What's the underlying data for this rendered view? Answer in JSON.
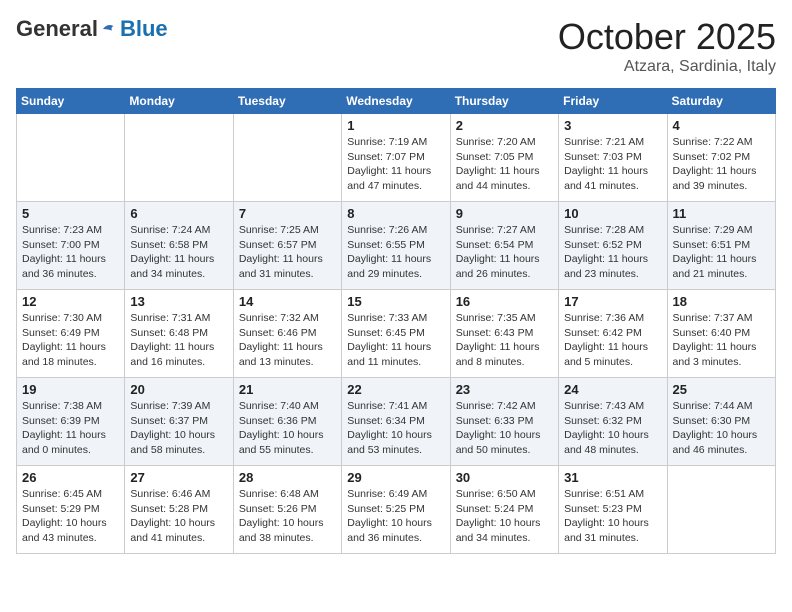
{
  "header": {
    "logo_general": "General",
    "logo_blue": "Blue",
    "month": "October 2025",
    "location": "Atzara, Sardinia, Italy"
  },
  "days_of_week": [
    "Sunday",
    "Monday",
    "Tuesday",
    "Wednesday",
    "Thursday",
    "Friday",
    "Saturday"
  ],
  "weeks": [
    [
      {
        "num": "",
        "sunrise": "",
        "sunset": "",
        "daylight": ""
      },
      {
        "num": "",
        "sunrise": "",
        "sunset": "",
        "daylight": ""
      },
      {
        "num": "",
        "sunrise": "",
        "sunset": "",
        "daylight": ""
      },
      {
        "num": "1",
        "sunrise": "Sunrise: 7:19 AM",
        "sunset": "Sunset: 7:07 PM",
        "daylight": "Daylight: 11 hours and 47 minutes."
      },
      {
        "num": "2",
        "sunrise": "Sunrise: 7:20 AM",
        "sunset": "Sunset: 7:05 PM",
        "daylight": "Daylight: 11 hours and 44 minutes."
      },
      {
        "num": "3",
        "sunrise": "Sunrise: 7:21 AM",
        "sunset": "Sunset: 7:03 PM",
        "daylight": "Daylight: 11 hours and 41 minutes."
      },
      {
        "num": "4",
        "sunrise": "Sunrise: 7:22 AM",
        "sunset": "Sunset: 7:02 PM",
        "daylight": "Daylight: 11 hours and 39 minutes."
      }
    ],
    [
      {
        "num": "5",
        "sunrise": "Sunrise: 7:23 AM",
        "sunset": "Sunset: 7:00 PM",
        "daylight": "Daylight: 11 hours and 36 minutes."
      },
      {
        "num": "6",
        "sunrise": "Sunrise: 7:24 AM",
        "sunset": "Sunset: 6:58 PM",
        "daylight": "Daylight: 11 hours and 34 minutes."
      },
      {
        "num": "7",
        "sunrise": "Sunrise: 7:25 AM",
        "sunset": "Sunset: 6:57 PM",
        "daylight": "Daylight: 11 hours and 31 minutes."
      },
      {
        "num": "8",
        "sunrise": "Sunrise: 7:26 AM",
        "sunset": "Sunset: 6:55 PM",
        "daylight": "Daylight: 11 hours and 29 minutes."
      },
      {
        "num": "9",
        "sunrise": "Sunrise: 7:27 AM",
        "sunset": "Sunset: 6:54 PM",
        "daylight": "Daylight: 11 hours and 26 minutes."
      },
      {
        "num": "10",
        "sunrise": "Sunrise: 7:28 AM",
        "sunset": "Sunset: 6:52 PM",
        "daylight": "Daylight: 11 hours and 23 minutes."
      },
      {
        "num": "11",
        "sunrise": "Sunrise: 7:29 AM",
        "sunset": "Sunset: 6:51 PM",
        "daylight": "Daylight: 11 hours and 21 minutes."
      }
    ],
    [
      {
        "num": "12",
        "sunrise": "Sunrise: 7:30 AM",
        "sunset": "Sunset: 6:49 PM",
        "daylight": "Daylight: 11 hours and 18 minutes."
      },
      {
        "num": "13",
        "sunrise": "Sunrise: 7:31 AM",
        "sunset": "Sunset: 6:48 PM",
        "daylight": "Daylight: 11 hours and 16 minutes."
      },
      {
        "num": "14",
        "sunrise": "Sunrise: 7:32 AM",
        "sunset": "Sunset: 6:46 PM",
        "daylight": "Daylight: 11 hours and 13 minutes."
      },
      {
        "num": "15",
        "sunrise": "Sunrise: 7:33 AM",
        "sunset": "Sunset: 6:45 PM",
        "daylight": "Daylight: 11 hours and 11 minutes."
      },
      {
        "num": "16",
        "sunrise": "Sunrise: 7:35 AM",
        "sunset": "Sunset: 6:43 PM",
        "daylight": "Daylight: 11 hours and 8 minutes."
      },
      {
        "num": "17",
        "sunrise": "Sunrise: 7:36 AM",
        "sunset": "Sunset: 6:42 PM",
        "daylight": "Daylight: 11 hours and 5 minutes."
      },
      {
        "num": "18",
        "sunrise": "Sunrise: 7:37 AM",
        "sunset": "Sunset: 6:40 PM",
        "daylight": "Daylight: 11 hours and 3 minutes."
      }
    ],
    [
      {
        "num": "19",
        "sunrise": "Sunrise: 7:38 AM",
        "sunset": "Sunset: 6:39 PM",
        "daylight": "Daylight: 11 hours and 0 minutes."
      },
      {
        "num": "20",
        "sunrise": "Sunrise: 7:39 AM",
        "sunset": "Sunset: 6:37 PM",
        "daylight": "Daylight: 10 hours and 58 minutes."
      },
      {
        "num": "21",
        "sunrise": "Sunrise: 7:40 AM",
        "sunset": "Sunset: 6:36 PM",
        "daylight": "Daylight: 10 hours and 55 minutes."
      },
      {
        "num": "22",
        "sunrise": "Sunrise: 7:41 AM",
        "sunset": "Sunset: 6:34 PM",
        "daylight": "Daylight: 10 hours and 53 minutes."
      },
      {
        "num": "23",
        "sunrise": "Sunrise: 7:42 AM",
        "sunset": "Sunset: 6:33 PM",
        "daylight": "Daylight: 10 hours and 50 minutes."
      },
      {
        "num": "24",
        "sunrise": "Sunrise: 7:43 AM",
        "sunset": "Sunset: 6:32 PM",
        "daylight": "Daylight: 10 hours and 48 minutes."
      },
      {
        "num": "25",
        "sunrise": "Sunrise: 7:44 AM",
        "sunset": "Sunset: 6:30 PM",
        "daylight": "Daylight: 10 hours and 46 minutes."
      }
    ],
    [
      {
        "num": "26",
        "sunrise": "Sunrise: 6:45 AM",
        "sunset": "Sunset: 5:29 PM",
        "daylight": "Daylight: 10 hours and 43 minutes."
      },
      {
        "num": "27",
        "sunrise": "Sunrise: 6:46 AM",
        "sunset": "Sunset: 5:28 PM",
        "daylight": "Daylight: 10 hours and 41 minutes."
      },
      {
        "num": "28",
        "sunrise": "Sunrise: 6:48 AM",
        "sunset": "Sunset: 5:26 PM",
        "daylight": "Daylight: 10 hours and 38 minutes."
      },
      {
        "num": "29",
        "sunrise": "Sunrise: 6:49 AM",
        "sunset": "Sunset: 5:25 PM",
        "daylight": "Daylight: 10 hours and 36 minutes."
      },
      {
        "num": "30",
        "sunrise": "Sunrise: 6:50 AM",
        "sunset": "Sunset: 5:24 PM",
        "daylight": "Daylight: 10 hours and 34 minutes."
      },
      {
        "num": "31",
        "sunrise": "Sunrise: 6:51 AM",
        "sunset": "Sunset: 5:23 PM",
        "daylight": "Daylight: 10 hours and 31 minutes."
      },
      {
        "num": "",
        "sunrise": "",
        "sunset": "",
        "daylight": ""
      }
    ]
  ]
}
